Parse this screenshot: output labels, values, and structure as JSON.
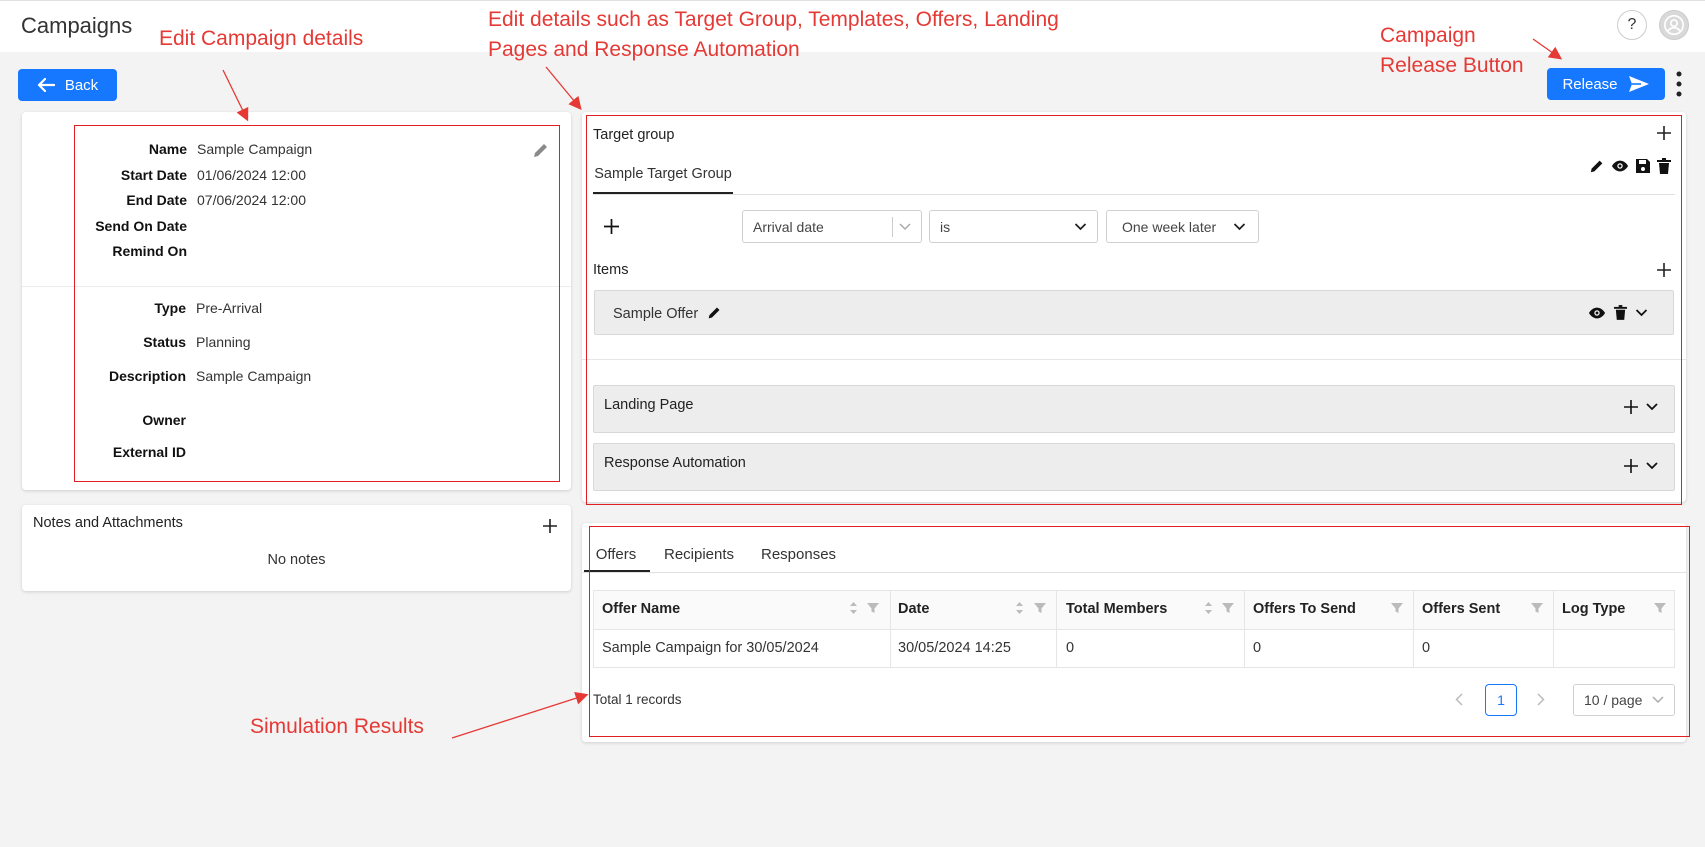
{
  "app": {
    "title": "Campaigns"
  },
  "header": {
    "help_label": "?"
  },
  "toolbar": {
    "back_label": "Back",
    "release_label": "Release"
  },
  "campaign": {
    "fields": [
      {
        "label": "Name",
        "value": "Sample Campaign"
      },
      {
        "label": "Start Date",
        "value": "01/06/2024 12:00"
      },
      {
        "label": "End Date",
        "value": "07/06/2024 12:00"
      },
      {
        "label": "Send On Date",
        "value": ""
      },
      {
        "label": "Remind On",
        "value": ""
      }
    ],
    "details": [
      {
        "label": "Type",
        "value": "Pre-Arrival"
      },
      {
        "label": "Status",
        "value": "Planning"
      },
      {
        "label": "Description",
        "value": "Sample Campaign"
      },
      {
        "label": "Owner",
        "value": ""
      },
      {
        "label": "External ID",
        "value": ""
      }
    ]
  },
  "notes": {
    "title": "Notes and Attachments",
    "empty_text": "No notes"
  },
  "target_group": {
    "title": "Target group",
    "tab_label": "Sample Target Group",
    "condition": {
      "field": "Arrival date",
      "operator": "is",
      "value": "One week later"
    },
    "items_title": "Items",
    "item_label": "Sample Offer"
  },
  "landing_page": {
    "title": "Landing Page"
  },
  "response_automation": {
    "title": "Response Automation"
  },
  "results": {
    "tabs": [
      "Offers",
      "Recipients",
      "Responses"
    ],
    "columns": [
      "Offer Name",
      "Date",
      "Total Members",
      "Offers To Send",
      "Offers Sent",
      "Log Type"
    ],
    "rows": [
      [
        "Sample Campaign for 30/05/2024",
        "30/05/2024 14:25",
        "0",
        "0",
        "0",
        ""
      ]
    ],
    "total_text": "Total 1 records",
    "current_page": "1",
    "page_size": "10 / page"
  },
  "annotations": {
    "edit_details": "Edit Campaign details",
    "edit_target_line1": "Edit details such as Target Group, Templates, Offers, Landing",
    "edit_target_line2": "Pages and Response Automation",
    "release_line1": "Campaign",
    "release_line2": "Release Button",
    "simulation": "Simulation Results"
  },
  "colors": {
    "primary": "#1677ff",
    "annotation": "#e53935",
    "background": "#f3f3f3"
  }
}
